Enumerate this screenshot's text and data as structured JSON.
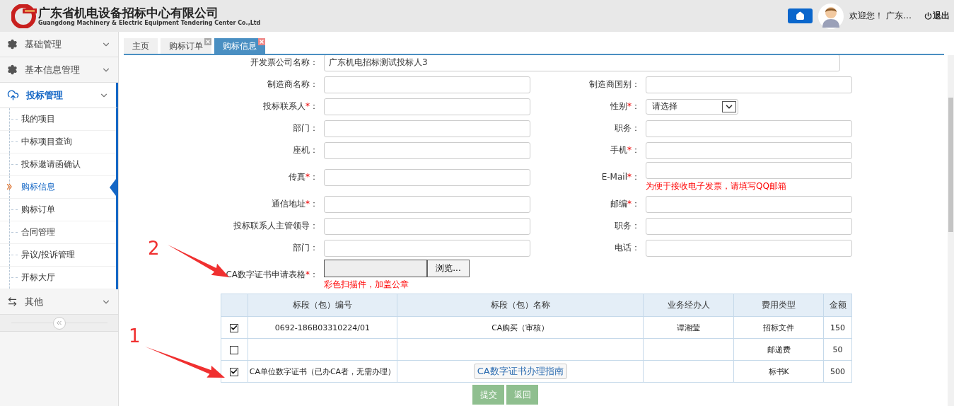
{
  "header": {
    "title": "广东省机电设备招标中心有限公司",
    "subtitle": "Guangdong Machinery & Electric Equipment Tendering Center Co.,Ltd",
    "welcome": "欢迎您！ 广东…",
    "logout": "退出"
  },
  "sidebar": {
    "groups": [
      {
        "label": "基础管理",
        "expanded": false
      },
      {
        "label": "基本信息管理",
        "expanded": false
      },
      {
        "label": "投标管理",
        "expanded": true,
        "items": [
          {
            "label": "我的项目",
            "selected": false
          },
          {
            "label": "中标项目查询",
            "selected": false
          },
          {
            "label": "投标邀请函确认",
            "selected": false
          },
          {
            "label": "购标信息",
            "selected": true
          },
          {
            "label": "购标订单",
            "selected": false
          },
          {
            "label": "合同管理",
            "selected": false
          },
          {
            "label": "异议/投诉管理",
            "selected": false
          },
          {
            "label": "开标大厅",
            "selected": false
          }
        ]
      },
      {
        "label": "其他",
        "expanded": false
      }
    ]
  },
  "tabs": [
    {
      "label": "主页",
      "selected": false,
      "closable": false
    },
    {
      "label": "购标订单",
      "selected": false,
      "closable": true
    },
    {
      "label": "购标信息",
      "selected": true,
      "closable": true
    }
  ],
  "form": {
    "rows": [
      {
        "fields": [
          {
            "kind": "wide",
            "label": "开发票公司名称",
            "colon": "：",
            "value": "广东机电招标测试投标人3"
          }
        ]
      },
      {
        "fields": [
          {
            "kind": "text",
            "label": "制造商名称",
            "colon": "："
          },
          {
            "kind": "text",
            "label": "制造商国别",
            "colon": "："
          }
        ]
      },
      {
        "fields": [
          {
            "kind": "text",
            "label": "投标联系人",
            "required": "*",
            "colon": "："
          },
          {
            "kind": "select",
            "label": "性别",
            "required": "*",
            "colon": "：",
            "value": "请选择"
          }
        ]
      },
      {
        "fields": [
          {
            "kind": "text",
            "label": "部门",
            "colon": "："
          },
          {
            "kind": "text",
            "label": "职务",
            "colon": "："
          }
        ]
      },
      {
        "fields": [
          {
            "kind": "text",
            "label": "座机",
            "colon": "："
          },
          {
            "kind": "text",
            "label": "手机",
            "required": "*",
            "colon": "："
          }
        ]
      },
      {
        "tall": true,
        "fields": [
          {
            "kind": "text",
            "label": "传真",
            "required": "*",
            "colon": "："
          },
          {
            "kind": "text",
            "label": "E-Mail",
            "required": "*",
            "colon": "：",
            "note": "为便于接收电子发票，请填写QQ邮箱"
          }
        ]
      },
      {
        "fields": [
          {
            "kind": "text",
            "label": "通信地址",
            "required": "*",
            "colon": "："
          },
          {
            "kind": "text",
            "label": "邮编",
            "required": "*",
            "colon": "："
          }
        ]
      },
      {
        "fields": [
          {
            "kind": "text",
            "label": "投标联系人主管领导",
            "colon": "："
          },
          {
            "kind": "text",
            "label": "职务",
            "colon": "："
          }
        ]
      },
      {
        "fields": [
          {
            "kind": "text",
            "label": "部门",
            "colon": "："
          },
          {
            "kind": "text",
            "label": "电话",
            "colon": "："
          }
        ]
      },
      {
        "tall": true,
        "fields": [
          {
            "kind": "file",
            "label": "CA数字证书申请表格",
            "required": "*",
            "colon": "：",
            "button": "浏览...",
            "note": "彩色扫描件，加盖公章"
          }
        ]
      }
    ]
  },
  "table": {
    "columns": [
      "标段（包）编号",
      "标段（包）名称",
      "业务经办人",
      "费用类型",
      "金额"
    ],
    "rows": [
      {
        "checked": true,
        "cells": [
          {
            "kind": "text",
            "text": "0692-186B03310224/01"
          },
          {
            "kind": "text",
            "text": "CA购买（审核）"
          },
          {
            "kind": "text",
            "text": "谭湘莹"
          },
          {
            "kind": "text",
            "text": "招标文件"
          },
          {
            "kind": "text",
            "text": "150"
          }
        ]
      },
      {
        "checked": false,
        "cells": [
          {
            "kind": "text"
          },
          {
            "kind": "text"
          },
          {
            "kind": "text"
          },
          {
            "kind": "text",
            "text": "邮递费"
          },
          {
            "kind": "text",
            "text": "50"
          }
        ]
      },
      {
        "checked": true,
        "cells": [
          {
            "kind": "text",
            "text": "CA单位数字证书（已办CA者，无需办理）"
          },
          {
            "kind": "button",
            "text": "CA数字证书办理指南"
          },
          {
            "kind": "text"
          },
          {
            "kind": "text",
            "text": "标书K"
          },
          {
            "kind": "text",
            "text": "500"
          }
        ]
      }
    ]
  },
  "actions": [
    "提交",
    "返回"
  ],
  "annotations": [
    {
      "label": "2"
    },
    {
      "label": "1"
    }
  ]
}
